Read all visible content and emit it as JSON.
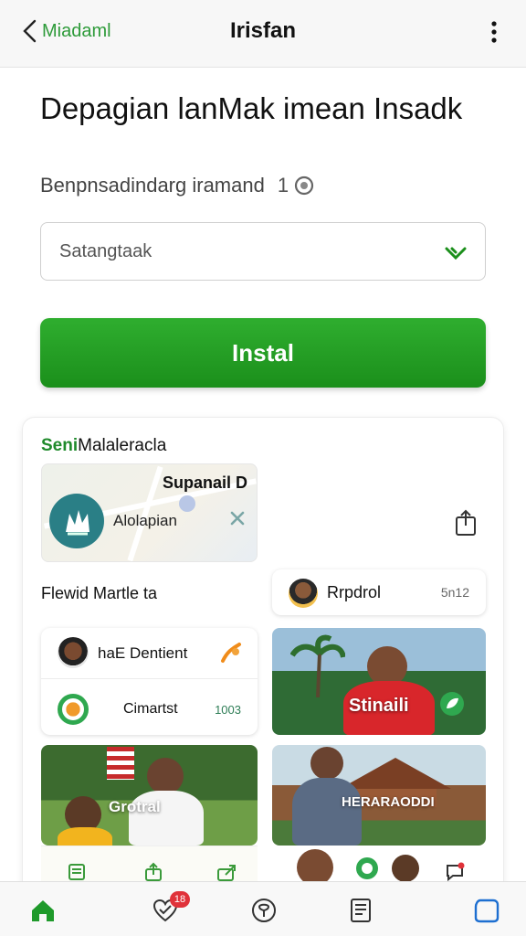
{
  "topbar": {
    "back_label": "Miadaml",
    "title": "Irisfan"
  },
  "main": {
    "heading": "Depagian lanMak imean Insadk",
    "subline_text": "Benpnsadindarg iramand",
    "subline_number": "1"
  },
  "select": {
    "placeholder": "Satangtaak"
  },
  "install_button": {
    "label": "Instal"
  },
  "panel": {
    "title_green": "Seni",
    "title_rest": "Malaleracla",
    "map_card": {
      "label": "Supanail D",
      "app_name": "Alolapian"
    },
    "section_label": "Flewid Martle ta",
    "chip": {
      "name": "Rrpdrol",
      "value": "5n12"
    },
    "list_card": {
      "row1_name": "haE Dentient",
      "row2_name": "Cimartst",
      "row2_value": "1003"
    },
    "photos": {
      "p1_caption": "Stinaili",
      "p2_caption": "Grotral",
      "p3_caption": "HERARAODDI"
    }
  },
  "nav": {
    "badge_count": "18"
  },
  "colors": {
    "accent_green": "#1b8f1b",
    "badge_red": "#e0323a",
    "link_green": "#2e9b3a"
  },
  "icons": [
    "back-chevron-icon",
    "more-vert-icon",
    "check-chevron-icon",
    "close-icon",
    "share-icon",
    "home-icon",
    "heart-check-icon",
    "pin-icon",
    "document-icon",
    "square-icon"
  ]
}
